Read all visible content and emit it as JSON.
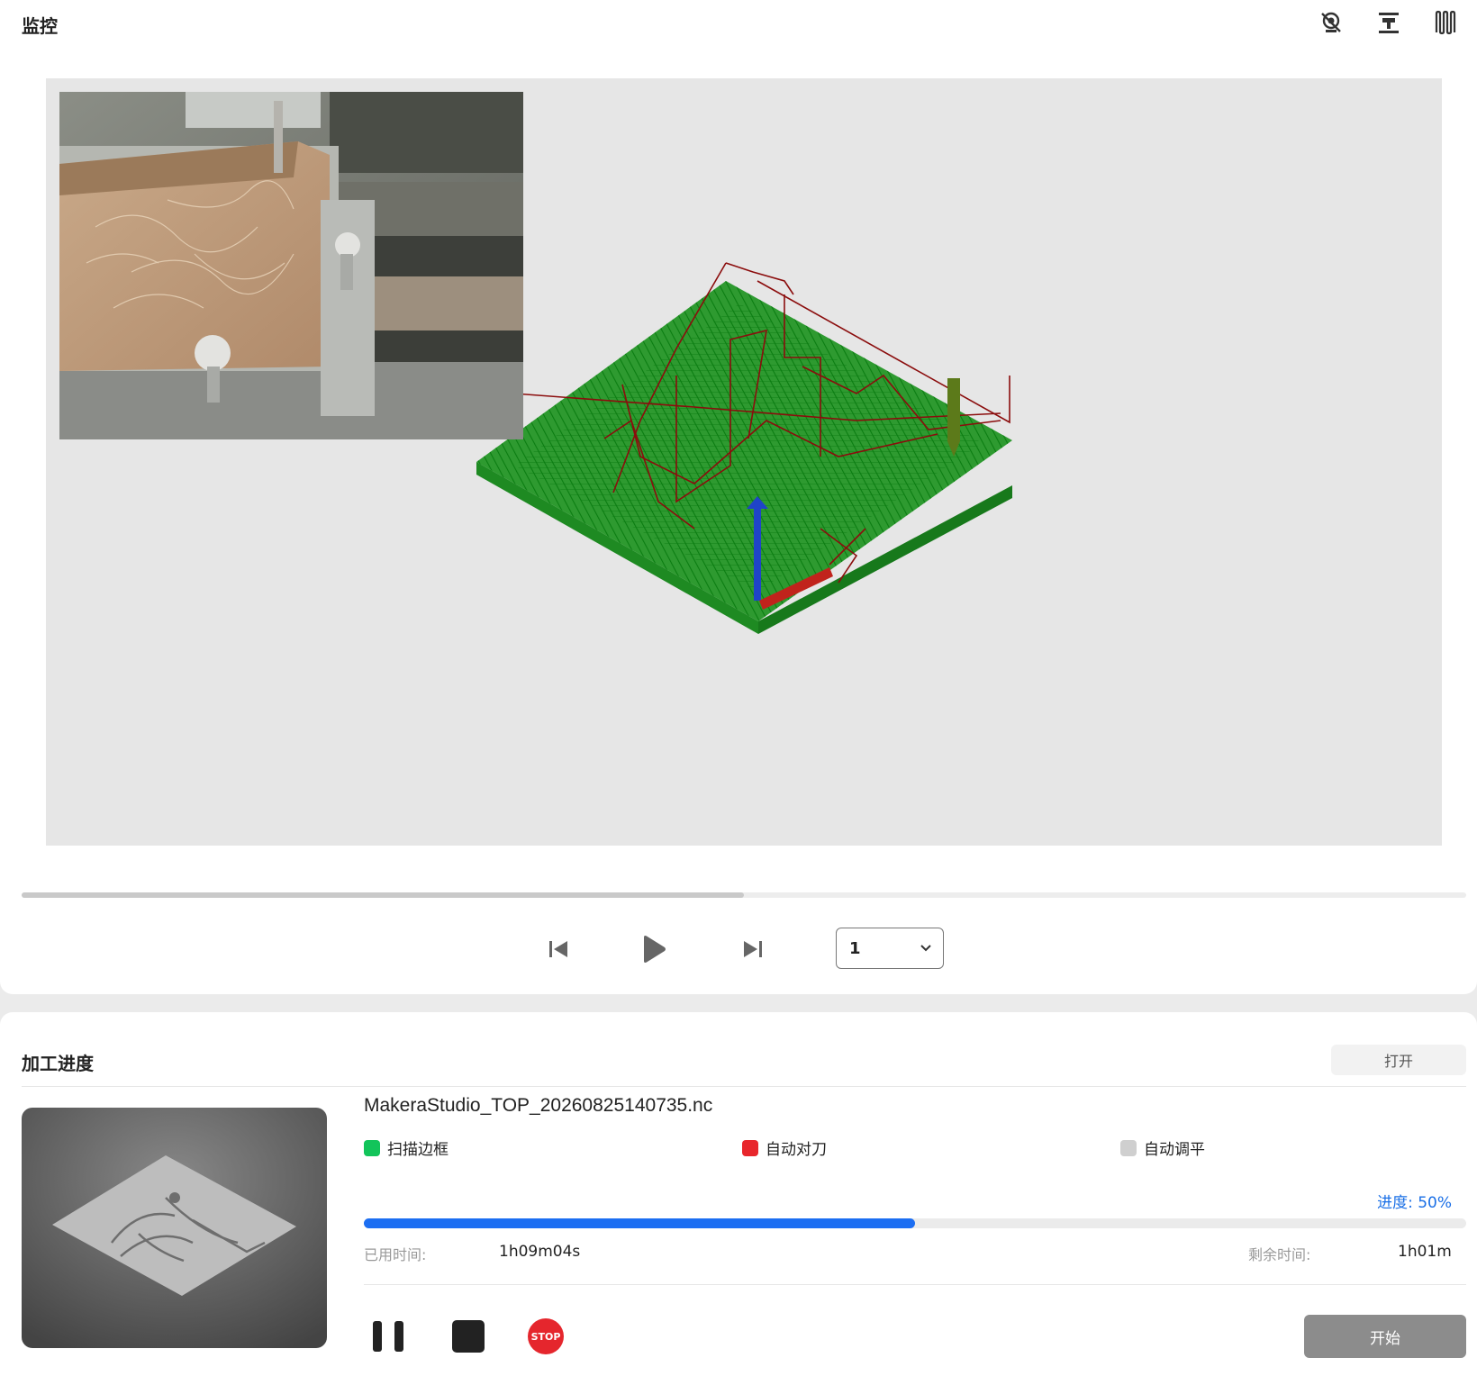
{
  "header": {
    "title": "监控",
    "icons": [
      "camera-off-icon",
      "spindle-icon",
      "toolpath-icon"
    ]
  },
  "playback": {
    "scrub_progress": 0.5,
    "speed_value": "1"
  },
  "job": {
    "section_title": "加工进度",
    "open_label": "打开",
    "filename": "MakeraStudio_TOP_20260825140735.nc",
    "steps": [
      {
        "label": "扫描边框",
        "color": "#12c45a"
      },
      {
        "label": "自动对刀",
        "color": "#e8262c"
      },
      {
        "label": "自动调平",
        "color": "#cfcfcf"
      }
    ],
    "progress_label": "进度:  50%",
    "progress_fraction": 0.5,
    "elapsed_label": "已用时间:",
    "elapsed_value": "1h09m04s",
    "remaining_label": "剩余时间:",
    "remaining_value": "1h01m",
    "stop_label": "STOP",
    "start_label": "开始"
  }
}
